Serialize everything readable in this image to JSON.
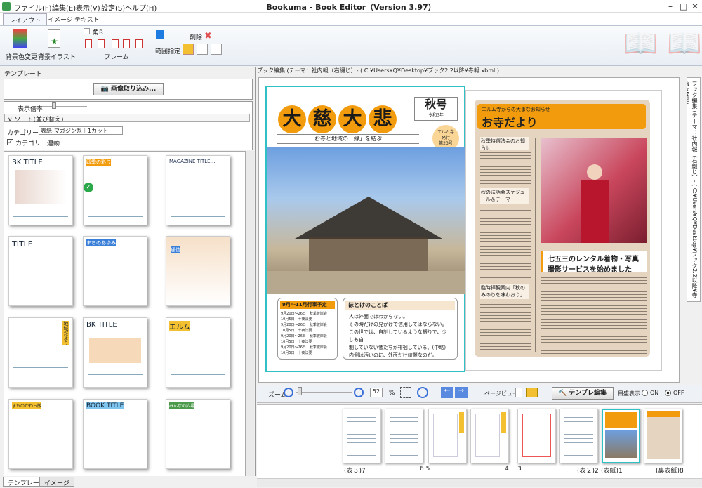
{
  "app": {
    "window_title": "Bookuma - Book Editor（Version 3.97）",
    "menu": [
      "ファイル(F)",
      "編集(E)",
      "表示(V)",
      "設定(S)",
      "ヘルプ(H)"
    ],
    "window_controls": {
      "minimize": "–",
      "maximize": "□",
      "close": "✕"
    }
  },
  "ribbon": {
    "tabs": [
      "レイアウト",
      "イメージ",
      "テキスト"
    ],
    "bg_color_label": "背景色変更",
    "bg_illust_label": "背景イラスト",
    "corner_r_label": "角R",
    "frame_label": "フレーム",
    "range_label": "範囲指定",
    "delete_label": "削除"
  },
  "left_panel": {
    "header": "テンプレート",
    "load_image_button": "画像取り込み...",
    "zoom_label": "表示倍率",
    "sort_label": "ソート(並び替え)",
    "category_label": "カテゴリー",
    "category_value": "表紙-マガジン系｜1カット",
    "category_link_label": "カテゴリー連動",
    "bottom_tabs": [
      "テンプレート",
      "イメージ"
    ],
    "thumbnails": [
      {
        "title": "BK TITLE"
      },
      {
        "title": "四季の彩り"
      },
      {
        "title": "MAGAZINE TITLE…"
      },
      {
        "title": "TITLE"
      },
      {
        "title": "まちのあゆみ"
      },
      {
        "title": "通信"
      },
      {
        "title": "地域だより"
      },
      {
        "title": "BK TITLE"
      },
      {
        "title": "エルム"
      },
      {
        "title": "まちのかわら版"
      },
      {
        "title": "BOOK TITLE"
      },
      {
        "title": "みんなの広場"
      }
    ]
  },
  "editor": {
    "header": "ブック編集 (テーマ：社内報（右綴じ）- ( C:¥Users¥Q¥Desktop¥ブック2.2以降¥寺報.xbml )",
    "vertical_tab": "ブック編集 (テーマ：社内報（右綴じ）- ( C:¥Users¥Q¥Desktop¥ブック2.2以降¥寺報.xbml)",
    "left_page": {
      "kanji": [
        "大",
        "慈",
        "大",
        "悲"
      ],
      "season": "秋号",
      "era": "令和3年",
      "badge": "エルム寺\n発行\n第23号",
      "subtitle": "お寺と地域の「縁」を結ぶ",
      "schedule_title": "9月～11月行事予定",
      "schedule_items": [
        "9月20日～26日　秋季彼岸会",
        "10月5日　十夜法要",
        "9月20日～26日　秋季彼岸会",
        "10月5日　十夜法要",
        "9月20日～26日　秋季彼岸会",
        "10月5日　十夜法要",
        "9月20日～26日　秋季彼岸会",
        "10月5日　十夜法要"
      ],
      "words_title": "ほとけのことば",
      "words_lines": [
        "人は外面ではわからない。",
        "その時だけの見かけで信用してはならない。",
        "この世では、自制しているような振りで、少しも自",
        "制していない者たちが徘徊している。(中略)",
        "内側は汚いのに、外面だけ綺麗なのだ。"
      ]
    },
    "right_page": {
      "kicker": "エルム寺からの大事なお知らせ",
      "headline": "お寺だより",
      "sections": [
        "秋季特選法会のお知らせ",
        "秋の法話会スケジュール＆テーマ",
        "臨時拝観案内「秋のみのりを味わおう」"
      ],
      "rental_title": "七五三のレンタル着物・写真撮影サービスを始めました"
    }
  },
  "zoom_bar": {
    "zoom_label": "ズーム",
    "zoom_value": "52",
    "percent": "%",
    "page_view_label": "ページビュー",
    "template_edit_button": "テンプレ編集",
    "layout_display_label": "目盛表示",
    "on_label": "ON",
    "off_label": "OFF"
  },
  "page_strip": {
    "labels": [
      "(表３)7",
      "6  5",
      "4",
      "3",
      "(表２)2",
      "(表紙)1",
      "(裏表紙)8"
    ]
  },
  "colors": {
    "accent": "#f29c0d",
    "frame": "#2fc1c6"
  }
}
